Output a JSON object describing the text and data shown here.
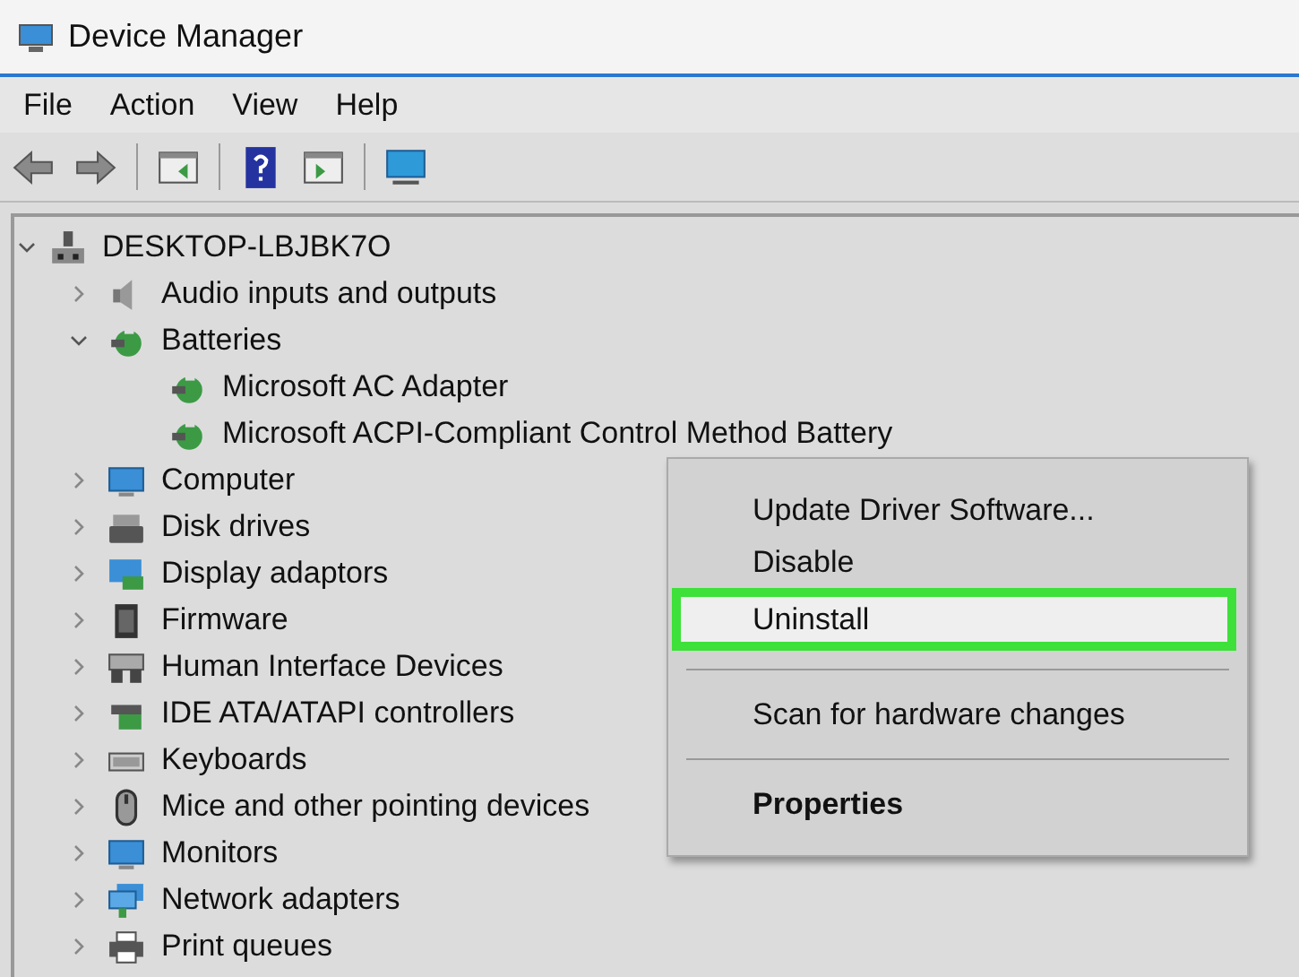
{
  "window": {
    "title": "Device Manager"
  },
  "menu": [
    "File",
    "Action",
    "View",
    "Help"
  ],
  "toolbar": [
    {
      "disabled": true
    },
    {
      "disabled": true
    },
    {
      "disabled": false
    },
    {
      "disabled": false
    },
    {
      "disabled": false
    },
    {
      "disabled": false
    }
  ],
  "tree": {
    "label": "DESKTOP-LBJBK7O",
    "expanded": true,
    "children": [
      {
        "label": "Audio inputs and outputs",
        "expanded": false
      },
      {
        "label": "Batteries",
        "expanded": true,
        "children": [
          {
            "label": "Microsoft AC Adapter"
          },
          {
            "label": "Microsoft ACPI-Compliant Control Method Battery"
          }
        ]
      },
      {
        "label": "Computer",
        "expanded": false
      },
      {
        "label": "Disk drives",
        "expanded": false
      },
      {
        "label": "Display adaptors",
        "expanded": false
      },
      {
        "label": "Firmware",
        "expanded": false
      },
      {
        "label": "Human Interface Devices",
        "expanded": false
      },
      {
        "label": "IDE ATA/ATAPI controllers",
        "expanded": false
      },
      {
        "label": "Keyboards",
        "expanded": false
      },
      {
        "label": "Mice and other pointing devices",
        "expanded": false
      },
      {
        "label": "Monitors",
        "expanded": false
      },
      {
        "label": "Network adapters",
        "expanded": false
      },
      {
        "label": "Print queues",
        "expanded": false
      }
    ]
  },
  "context_menu": [
    {
      "kind": "item",
      "label": "Update Driver Software...",
      "selected": false
    },
    {
      "kind": "item",
      "label": "Disable",
      "selected": false
    },
    {
      "kind": "item",
      "label": "Uninstall",
      "selected": true
    },
    {
      "kind": "separator"
    },
    {
      "kind": "item",
      "label": "Scan for hardware changes",
      "selected": false
    },
    {
      "kind": "separator"
    },
    {
      "kind": "default",
      "label": "Properties",
      "selected": false
    }
  ]
}
